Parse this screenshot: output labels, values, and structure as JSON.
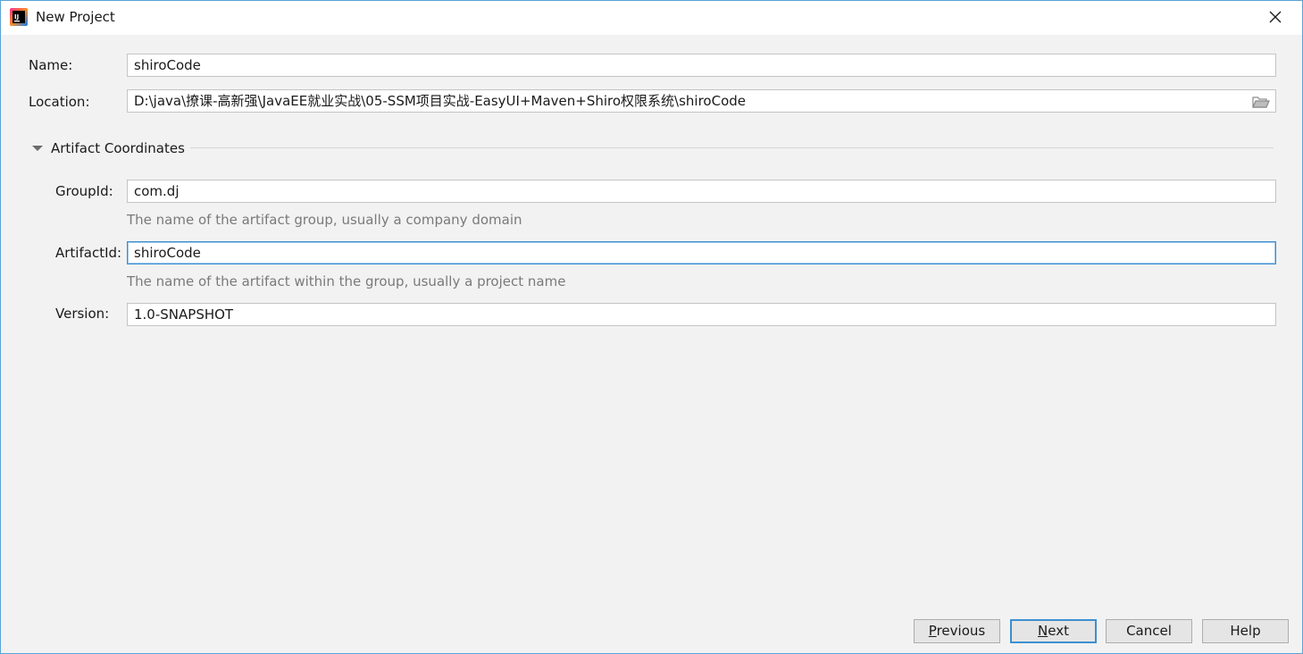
{
  "window": {
    "title": "New Project",
    "accent_color": "#3d8fd1"
  },
  "form": {
    "name": {
      "label": "Name:",
      "value": "shiroCode"
    },
    "location": {
      "label": "Location:",
      "value": "D:\\java\\撩课-高新强\\JavaEE就业实战\\05-SSM项目实战-EasyUI+Maven+Shiro权限系统\\shiroCode"
    }
  },
  "artifact": {
    "section_title": "Artifact Coordinates",
    "group_id": {
      "label": "GroupId:",
      "value": "com.dj",
      "hint": "The name of the artifact group, usually a company domain"
    },
    "artifact_id": {
      "label": "ArtifactId:",
      "value": "shiroCode",
      "hint": "The name of the artifact within the group, usually a project name"
    },
    "version": {
      "label": "Version:",
      "value": "1.0-SNAPSHOT"
    }
  },
  "buttons": {
    "previous": {
      "mnemonic": "P",
      "rest": "revious"
    },
    "next": {
      "mnemonic": "N",
      "rest": "ext"
    },
    "cancel": "Cancel",
    "help": "Help"
  },
  "icons": {
    "app": "intellij-idea-icon",
    "close": "close-icon",
    "folder": "folder-open-icon",
    "toggle": "triangle-down-icon"
  }
}
